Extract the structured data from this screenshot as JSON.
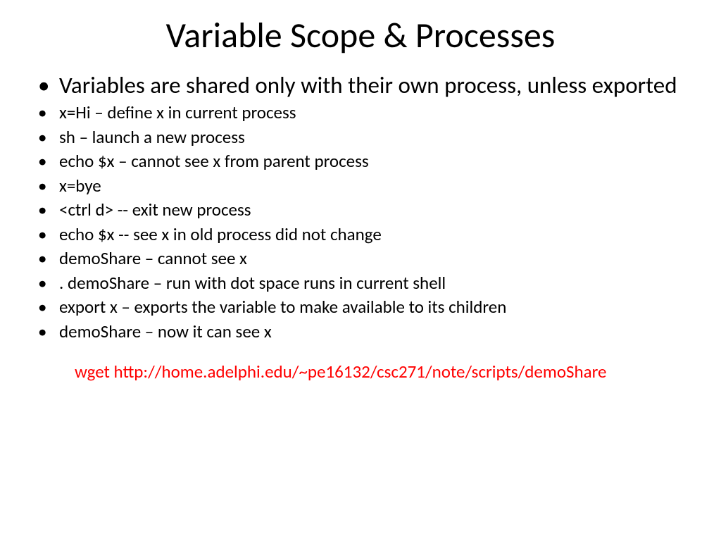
{
  "title": "Variable Scope & Processes",
  "bullets": {
    "lead": "Variables are shared only with their own process, unless exported",
    "items": [
      "x=Hi – define x in current process",
      "sh – launch a new process",
      "echo $x – cannot see x from parent process",
      "x=bye",
      "<ctrl d> -- exit new process",
      "echo $x  -- see x in old process did not change",
      "demoShare – cannot see x",
      ". demoShare – run with dot space runs in current shell",
      "export x – exports the variable to make available to its children",
      "demoShare – now it can see x"
    ]
  },
  "footer": "wget http://home.adelphi.edu/~pe16132/csc271/note/scripts/demoShare"
}
